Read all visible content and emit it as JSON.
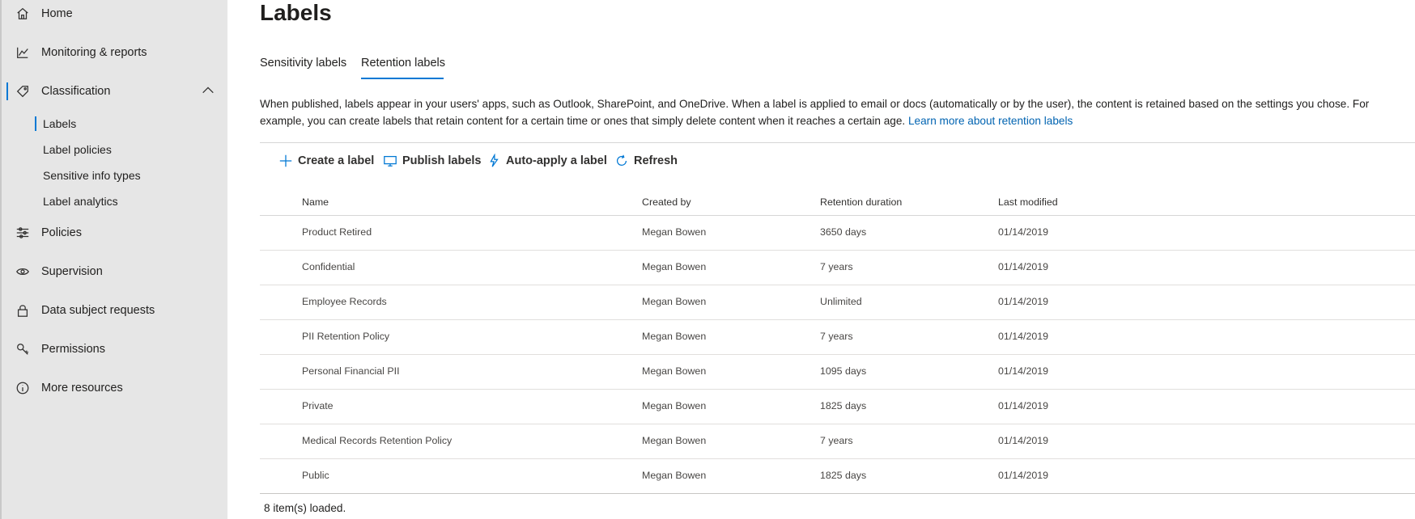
{
  "sidebar": {
    "items": [
      {
        "label": "Home",
        "icon": "home-icon"
      },
      {
        "label": "Monitoring & reports",
        "icon": "chart-icon"
      },
      {
        "label": "Classification",
        "icon": "tag-icon"
      },
      {
        "label": "Policies",
        "icon": "sliders-icon"
      },
      {
        "label": "Supervision",
        "icon": "eye-icon"
      },
      {
        "label": "Data subject requests",
        "icon": "lock-icon"
      },
      {
        "label": "Permissions",
        "icon": "key-icon"
      },
      {
        "label": "More resources",
        "icon": "info-icon"
      }
    ],
    "sub_items": [
      {
        "label": "Labels"
      },
      {
        "label": "Label policies"
      },
      {
        "label": "Sensitive info types"
      },
      {
        "label": "Label analytics"
      }
    ]
  },
  "page": {
    "title": "Labels",
    "tabs": [
      {
        "label": "Sensitivity labels"
      },
      {
        "label": "Retention labels"
      }
    ],
    "description": "When published, labels appear in your users' apps, such as Outlook, SharePoint, and OneDrive. When a label is applied to email or docs (automatically or by the user), the content is retained based on the settings you chose. For example, you can create labels that retain content for a certain time or ones that simply delete content when it reaches a certain age.",
    "learn_more": "Learn more about retention labels"
  },
  "toolbar": {
    "create": "Create a label",
    "publish": "Publish labels",
    "auto_apply": "Auto-apply a label",
    "refresh": "Refresh"
  },
  "table": {
    "columns": [
      "Name",
      "Created by",
      "Retention duration",
      "Last modified"
    ],
    "rows": [
      [
        "Product Retired",
        "Megan Bowen",
        "3650 days",
        "01/14/2019"
      ],
      [
        "Confidential",
        "Megan Bowen",
        "7 years",
        "01/14/2019"
      ],
      [
        "Employee Records",
        "Megan Bowen",
        "Unlimited",
        "01/14/2019"
      ],
      [
        "PII Retention Policy",
        "Megan Bowen",
        "7 years",
        "01/14/2019"
      ],
      [
        "Personal Financial PII",
        "Megan Bowen",
        "1095 days",
        "01/14/2019"
      ],
      [
        "Private",
        "Megan Bowen",
        "1825 days",
        "01/14/2019"
      ],
      [
        "Medical Records Retention Policy",
        "Megan Bowen",
        "7 years",
        "01/14/2019"
      ],
      [
        "Public",
        "Megan Bowen",
        "1825 days",
        "01/14/2019"
      ]
    ]
  },
  "footer": {
    "status": "8 item(s) loaded."
  },
  "colors": {
    "accent": "#0078d4",
    "sidebar_bg": "#e6e6e6",
    "link": "#0063b1"
  }
}
